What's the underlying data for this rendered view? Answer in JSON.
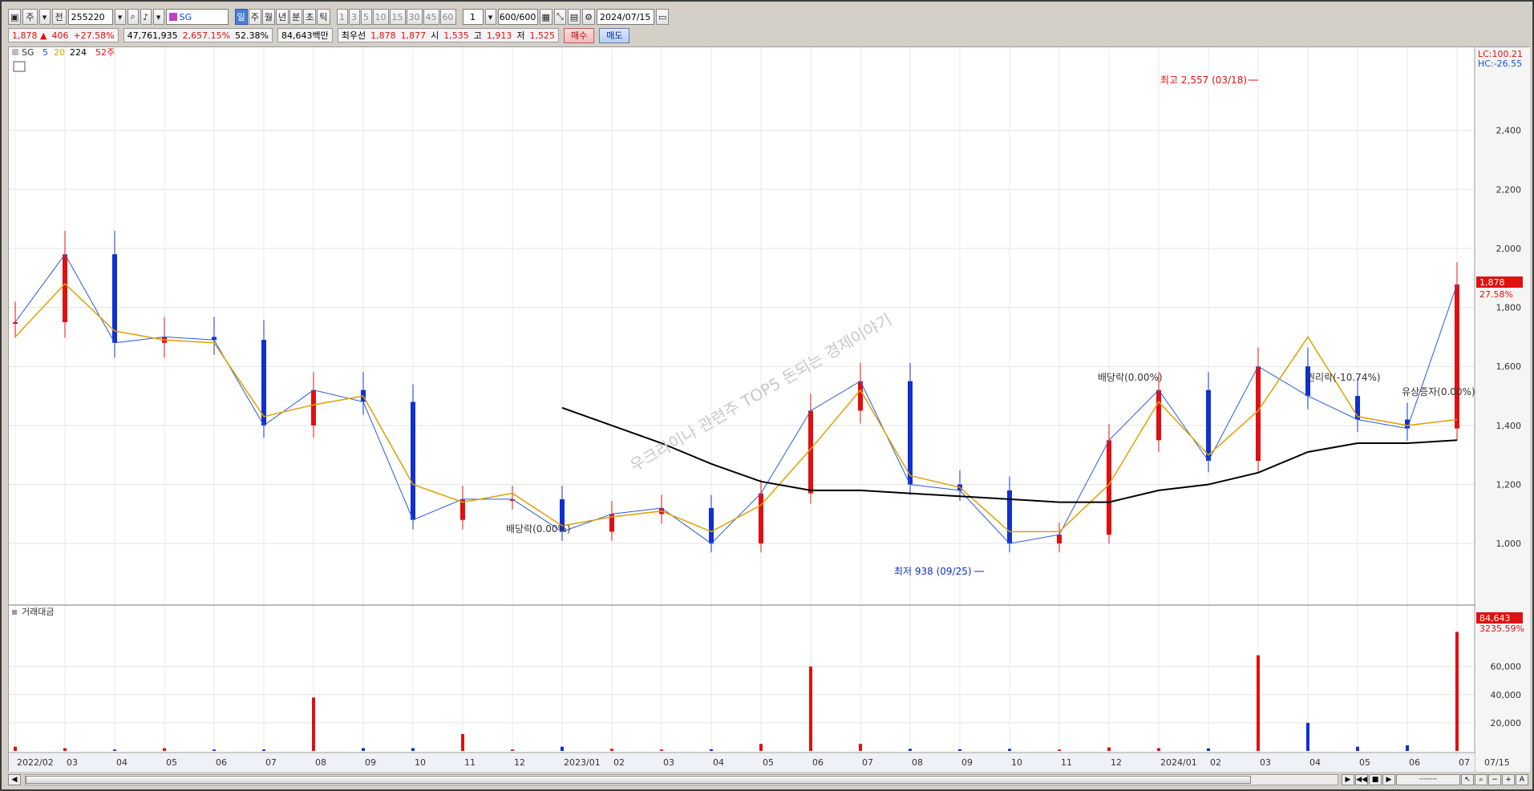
{
  "toolbar": {
    "mode_day": "주",
    "mode_prev": "전",
    "stock_code": "255220",
    "stock_name": "SG",
    "periods": [
      "일",
      "주",
      "월",
      "년",
      "분",
      "초",
      "틱"
    ],
    "active_period": "일",
    "intervals": [
      "1",
      "3",
      "5",
      "10",
      "15",
      "30",
      "45",
      "60"
    ],
    "interval_value": "1",
    "count": "600/600",
    "date": "2024/07/15"
  },
  "info": {
    "price": "1,878 ▲",
    "change": "406",
    "change_pct": "+27.58%",
    "volume": "47,761,935",
    "volume_pct": "2,657.15%",
    "turnover_pct": "52.38%",
    "amount": "84,643백만",
    "best_ask_label": "최우선",
    "best_ask": "1,878",
    "best_bid": "1,877",
    "open_label": "시",
    "open": "1,535",
    "high_label": "고",
    "high": "1,913",
    "low_label": "저",
    "low": "1,525",
    "buy_label": "매수",
    "sell_label": "매도"
  },
  "price_panel": {
    "legend_name": "SG",
    "legend_ma": [
      "5",
      "20",
      "224"
    ],
    "legend_52w": "52주",
    "lc_label": "LC:100.21",
    "hc_label": "HC:-26.55",
    "current_price_tag": "1,878",
    "current_pct_tag": "27.58%",
    "y_ticks": [
      "2,400",
      "2,200",
      "2,000",
      "1,800",
      "1,600",
      "1,400",
      "1,200",
      "1,000"
    ],
    "annotations": {
      "high": "최고 2,557 (03/18)",
      "low": "최저 938 (09/25)",
      "ex_dividend_1": "배당락(0.00%)",
      "ex_dividend_2": "배당락(0.00%)",
      "ex_rights": "권리락(-10.74%)",
      "rights_issue": "유상증자(0.00%)"
    },
    "watermark": "우크라이나 관련주 TOP5 돈되는 경제이야기"
  },
  "volume_panel": {
    "title": "거래대금",
    "y_ticks": [
      "60,000",
      "40,000",
      "20,000"
    ],
    "current_tag": "84,643",
    "current_pct": "3235.59%"
  },
  "x_axis": {
    "labels": [
      "2022/02",
      "03",
      "04",
      "05",
      "06",
      "07",
      "08",
      "09",
      "10",
      "11",
      "12",
      "2023/01",
      "02",
      "03",
      "04",
      "05",
      "06",
      "07",
      "08",
      "09",
      "10",
      "11",
      "12",
      "2024/01",
      "02",
      "03",
      "04",
      "05",
      "06",
      "07"
    ],
    "last_date": "07/15"
  },
  "chart_data": {
    "type": "line",
    "title": "",
    "xlabel": "",
    "ylabel": "",
    "ylim": [
      900,
      2600
    ],
    "x": [
      "2022/02",
      "2022/03",
      "2022/04",
      "2022/05",
      "2022/06",
      "2022/07",
      "2022/08",
      "2022/09",
      "2022/10",
      "2022/11",
      "2022/12",
      "2023/01",
      "2023/02",
      "2023/03",
      "2023/04",
      "2023/05",
      "2023/06",
      "2023/07",
      "2023/08",
      "2023/09",
      "2023/10",
      "2023/11",
      "2023/12",
      "2024/01",
      "2024/02",
      "2024/03",
      "2024/04",
      "2024/05",
      "2024/06",
      "2024/07"
    ],
    "series": [
      {
        "name": "5",
        "values": [
          1750,
          1980,
          1680,
          1700,
          1690,
          1400,
          1520,
          1480,
          1080,
          1150,
          1150,
          1040,
          1100,
          1120,
          1000,
          1170,
          1450,
          1550,
          1200,
          1180,
          1000,
          1030,
          1350,
          1520,
          1280,
          1600,
          1500,
          1420,
          1390,
          1878
        ]
      },
      {
        "name": "20",
        "values": [
          1700,
          1880,
          1720,
          1690,
          1680,
          1430,
          1470,
          1500,
          1200,
          1140,
          1170,
          1060,
          1090,
          1110,
          1040,
          1130,
          1320,
          1520,
          1230,
          1190,
          1040,
          1040,
          1200,
          1480,
          1300,
          1450,
          1700,
          1430,
          1400,
          1420
        ]
      },
      {
        "name": "224",
        "values": [
          null,
          null,
          null,
          null,
          null,
          null,
          null,
          null,
          null,
          null,
          null,
          1460,
          1400,
          1340,
          1270,
          1210,
          1180,
          1180,
          1170,
          1160,
          1150,
          1140,
          1140,
          1180,
          1200,
          1240,
          1310,
          1340,
          1340,
          1350
        ]
      }
    ],
    "volume": [
      3000,
      2000,
      1000,
      2000,
      1000,
      1000,
      38000,
      2000,
      2000,
      12000,
      1000,
      3000,
      1500,
      1000,
      1200,
      5000,
      60000,
      5000,
      1500,
      1200,
      1500,
      1000,
      2500,
      2000,
      1800,
      68000,
      20000,
      3000,
      4000,
      84643
    ]
  }
}
